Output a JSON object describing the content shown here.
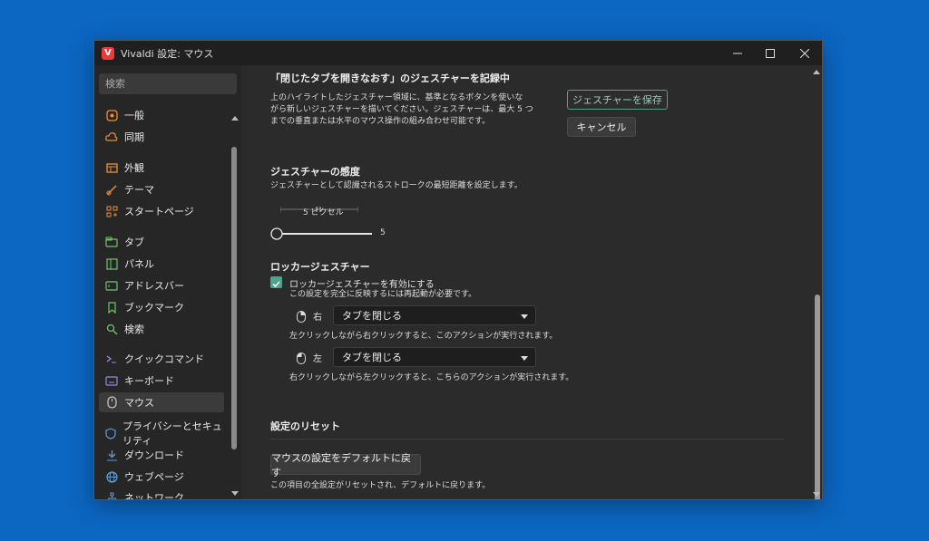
{
  "window": {
    "title": "Vivaldi 設定: マウス",
    "logo_letter": "V"
  },
  "sidebar": {
    "search_placeholder": "検索",
    "items": [
      {
        "label": "一般",
        "icon": "general-icon"
      },
      {
        "label": "同期",
        "icon": "cloud-icon"
      },
      {
        "label": "外観",
        "icon": "appearance-icon"
      },
      {
        "label": "テーマ",
        "icon": "brush-icon"
      },
      {
        "label": "スタートページ",
        "icon": "grid-icon"
      },
      {
        "label": "タブ",
        "icon": "tab-icon"
      },
      {
        "label": "パネル",
        "icon": "panel-icon"
      },
      {
        "label": "アドレスバー",
        "icon": "address-icon"
      },
      {
        "label": "ブックマーク",
        "icon": "bookmark-icon"
      },
      {
        "label": "検索",
        "icon": "search-icon"
      },
      {
        "label": "クイックコマンド",
        "icon": "command-icon"
      },
      {
        "label": "キーボード",
        "icon": "keyboard-icon"
      },
      {
        "label": "マウス",
        "icon": "mouse-icon"
      },
      {
        "label": "プライバシーとセキュリティ",
        "icon": "shield-icon"
      },
      {
        "label": "ダウンロード",
        "icon": "download-icon"
      },
      {
        "label": "ウェブページ",
        "icon": "globe-icon"
      },
      {
        "label": "ネットワーク",
        "icon": "network-icon"
      }
    ]
  },
  "gesture_record": {
    "heading": "「閉じたタブを開きなおす」のジェスチャーを記録中",
    "desc_lines": [
      "上のハイライトしたジェスチャー領域に、基準となるボタンを使いな",
      "がら新しいジェスチャーを描いてください。ジェスチャーは、最大 5 つ",
      "までの垂直または水平のマウス操作の組み合わせ可能です。"
    ],
    "save_label": "ジェスチャーを保存",
    "cancel_label": "キャンセル"
  },
  "sensitivity": {
    "heading": "ジェスチャーの感度",
    "desc": "ジェスチャーとして認識されるストロークの最短距離を設定します。",
    "preview_label": "5 ピクセル",
    "slider_value": "5"
  },
  "rocker": {
    "heading": "ロッカージェスチャー",
    "checkbox_label": "ロッカージェスチャーを有効にする",
    "checkbox_sub": "この設定を完全に反映するには再起動が必要です。",
    "right": {
      "label": "右",
      "value": "タブを閉じる",
      "desc": "左クリックしながら右クリックすると、このアクションが実行されます。"
    },
    "left": {
      "label": "左",
      "value": "タブを閉じる",
      "desc": "右クリックしながら左クリックすると、こちらのアクションが実行されます。"
    }
  },
  "reset": {
    "heading": "設定のリセット",
    "button_label": "マウスの設定をデフォルトに戻す",
    "desc": "この項目の全設定がリセットされ、デフォルトに戻ります。"
  },
  "colors": {
    "accent_green": "#4fa38a",
    "icon_orange": "#e8903a",
    "icon_green": "#6fc36f",
    "icon_blue": "#5aa0e0",
    "desktop_bg": "#0b67c2"
  }
}
